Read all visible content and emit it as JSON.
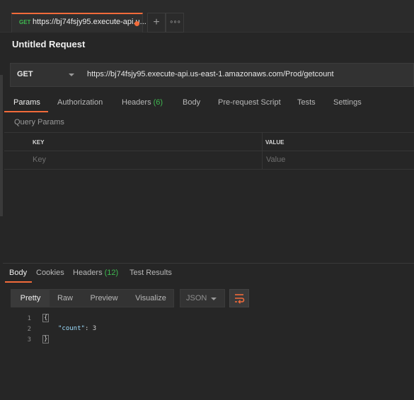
{
  "tab": {
    "method": "GET",
    "title": "https://bj74fsjy95.execute-api.u..."
  },
  "tabbar": {
    "add_icon": "+",
    "more_icon": "∘∘∘"
  },
  "request": {
    "name": "Untitled Request",
    "method": "GET",
    "url": "https://bj74fsjy95.execute-api.us-east-1.amazonaws.com/Prod/getcount"
  },
  "request_tabs": {
    "params": "Params",
    "authorization": "Authorization",
    "headers": "Headers",
    "headers_count": "(6)",
    "body": "Body",
    "prerequest": "Pre-request Script",
    "tests": "Tests",
    "settings": "Settings"
  },
  "query_params": {
    "label": "Query Params",
    "key_header": "KEY",
    "value_header": "VALUE",
    "key_placeholder": "Key",
    "value_placeholder": "Value"
  },
  "response_tabs": {
    "body": "Body",
    "cookies": "Cookies",
    "headers": "Headers",
    "headers_count": "(12)",
    "test_results": "Test Results"
  },
  "view_modes": {
    "pretty": "Pretty",
    "raw": "Raw",
    "preview": "Preview",
    "visualize": "Visualize",
    "format": "JSON"
  },
  "response_body": {
    "lines": [
      "1",
      "2",
      "3"
    ],
    "open_brace": "{",
    "key": "\"count\"",
    "colon": ": ",
    "value": "3",
    "close_brace": "}"
  },
  "colors": {
    "accent": "#f26b3a",
    "method_get": "#3fb950",
    "count": "#3fb950"
  }
}
